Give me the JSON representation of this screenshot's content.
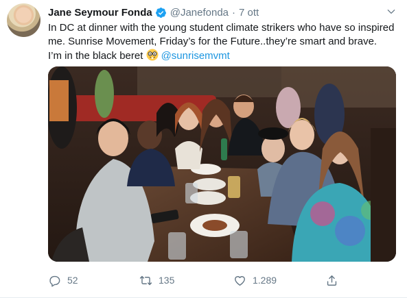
{
  "tweet": {
    "author_name": "Jane Seymour Fonda",
    "handle": "@Janefonda",
    "separator": "·",
    "date": "7 ott",
    "text_line1": "In DC at dinner with the young student climate strikers who have so inspired",
    "text_line2": "me. Sunrise Movement, Friday’s for the Future..they’re smart and brave.",
    "text_line3": "I’m in the black beret",
    "mention": "@sunrisemvmt",
    "emoji": "nerd-face-emoji"
  },
  "actions": {
    "replies": "52",
    "retweets": "135",
    "likes": "1.289"
  },
  "colors": {
    "link": "#1b95e0",
    "secondary_text": "#657786",
    "verified": "#1da1f2"
  },
  "icons": [
    "verified-icon",
    "chevron-down-icon",
    "reply-icon",
    "retweet-icon",
    "like-icon",
    "share-icon"
  ]
}
